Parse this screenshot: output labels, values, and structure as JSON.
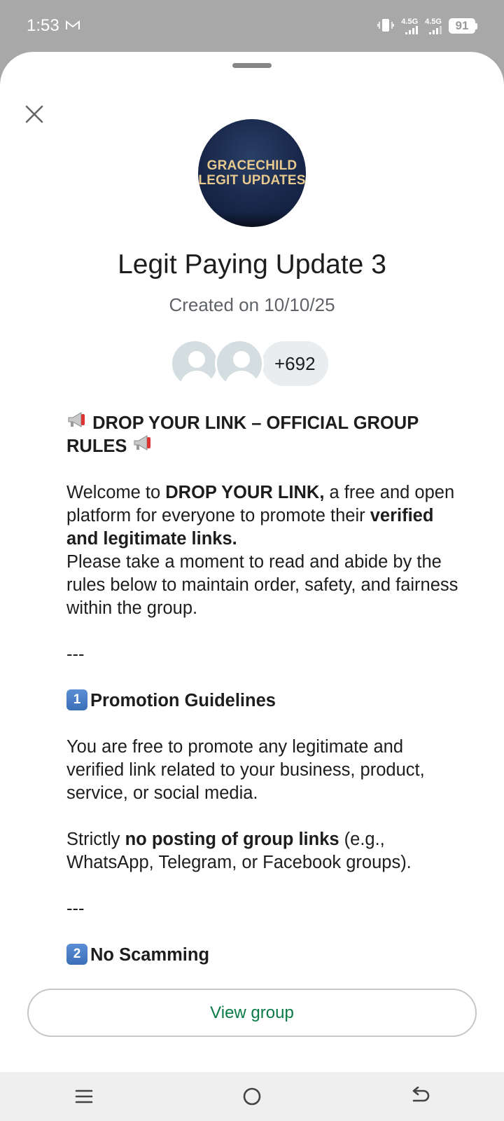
{
  "status_bar": {
    "time": "1:53",
    "network_1": "4.5G",
    "network_2": "4.5G",
    "battery": "91",
    "icons": [
      "gmail-icon",
      "vibrate-icon",
      "signal-icon",
      "signal-icon",
      "battery-icon"
    ]
  },
  "sheet": {
    "avatar_text_line1": "GRACECHILD",
    "avatar_text_line2": "LEGIT UPDATES",
    "title": "Legit Paying Update 3",
    "created": "Created on 10/10/25",
    "member_count": "+692"
  },
  "description": {
    "heading": "DROP YOUR LINK – OFFICIAL GROUP RULES",
    "welcome_pre": "Welcome to ",
    "welcome_bold": "DROP YOUR LINK,",
    "welcome_mid": " a free and open platform for everyone to promote their ",
    "welcome_bold2": "verified and legitimate links.",
    "welcome_post": "Please take a moment to read and abide by the rules below to maintain order, safety, and fairness within the group.",
    "separator": "---",
    "section1_num": "1",
    "section1_title": "Promotion Guidelines",
    "section1_p1": "You are free to promote any legitimate and verified link related to your business, product, service, or social media.",
    "section1_p2_pre": "Strictly ",
    "section1_p2_bold": "no posting of group links",
    "section1_p2_post": " (e.g., WhatsApp, Telegram, or Facebook groups).",
    "section2_num": "2",
    "section2_title": "No Scamming"
  },
  "actions": {
    "view_group": "View group"
  },
  "colors": {
    "accent_green": "#0b7a47",
    "backdrop": "#a8a8a8"
  }
}
